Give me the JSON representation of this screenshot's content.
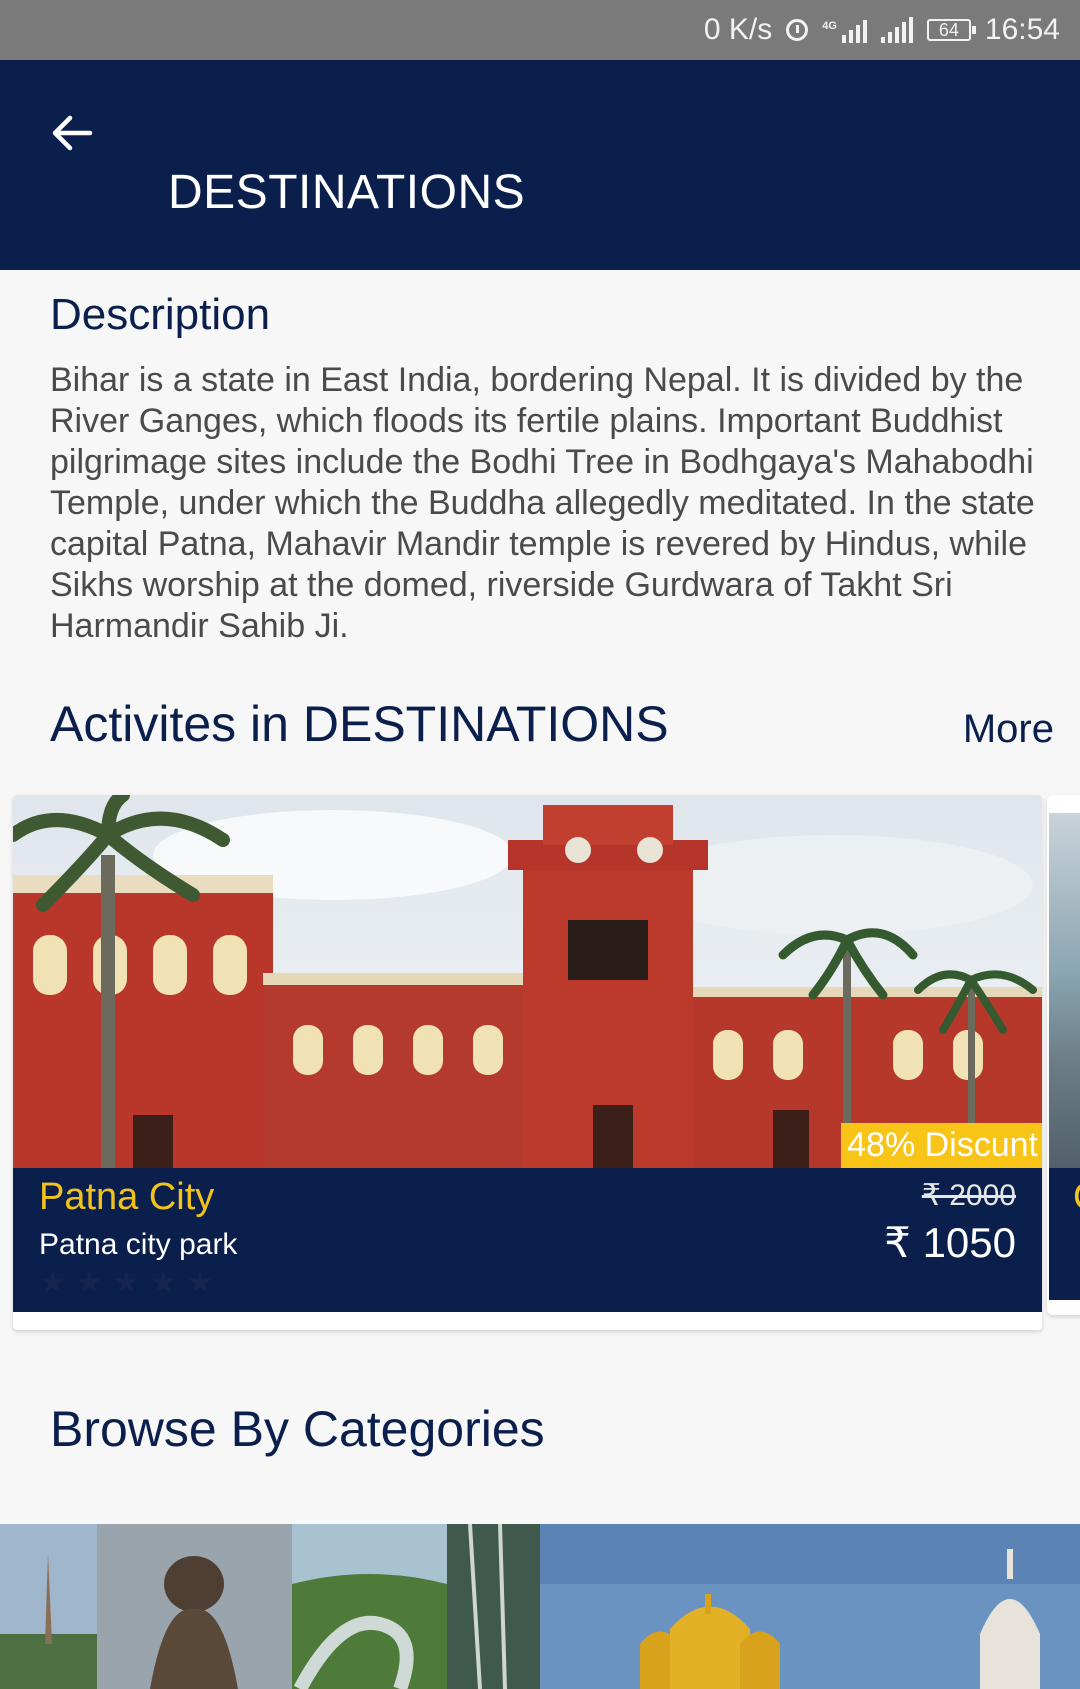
{
  "status_bar": {
    "speed": "0 K/s",
    "network_type": "4G",
    "battery": "64",
    "time": "16:54"
  },
  "app_bar": {
    "title": "DESTINATIONS",
    "back_icon": "arrow-left-icon"
  },
  "description": {
    "heading": "Description",
    "text": "Bihar is a state in East India, bordering Nepal. It is divided by the River Ganges, which floods its fertile plains. Important Buddhist pilgrimage sites include the Bodhi Tree in Bodhgaya's Mahabodhi Temple, under which the Buddha allegedly meditated. In the state capital Patna, Mahavir Mandir temple is revered by Hindus, while Sikhs worship at the domed, riverside Gurdwara of Takht Sri Harmandir Sahib Ji."
  },
  "activities": {
    "heading": "Activites in DESTINATIONS",
    "more_label": "More",
    "cards": [
      {
        "title": "Patna City",
        "subtitle": "Patna city park",
        "discount": "48% Discunt",
        "old_price": "₹ 2000",
        "new_price": "₹ 1050",
        "rating": 0,
        "rating_max": 5
      }
    ],
    "peek_card_initial": "C"
  },
  "categories": {
    "heading": "Browse By Categories"
  },
  "colors": {
    "primary": "#0b1f4d",
    "accent": "#f2c31a",
    "badge": "#f9c418"
  }
}
